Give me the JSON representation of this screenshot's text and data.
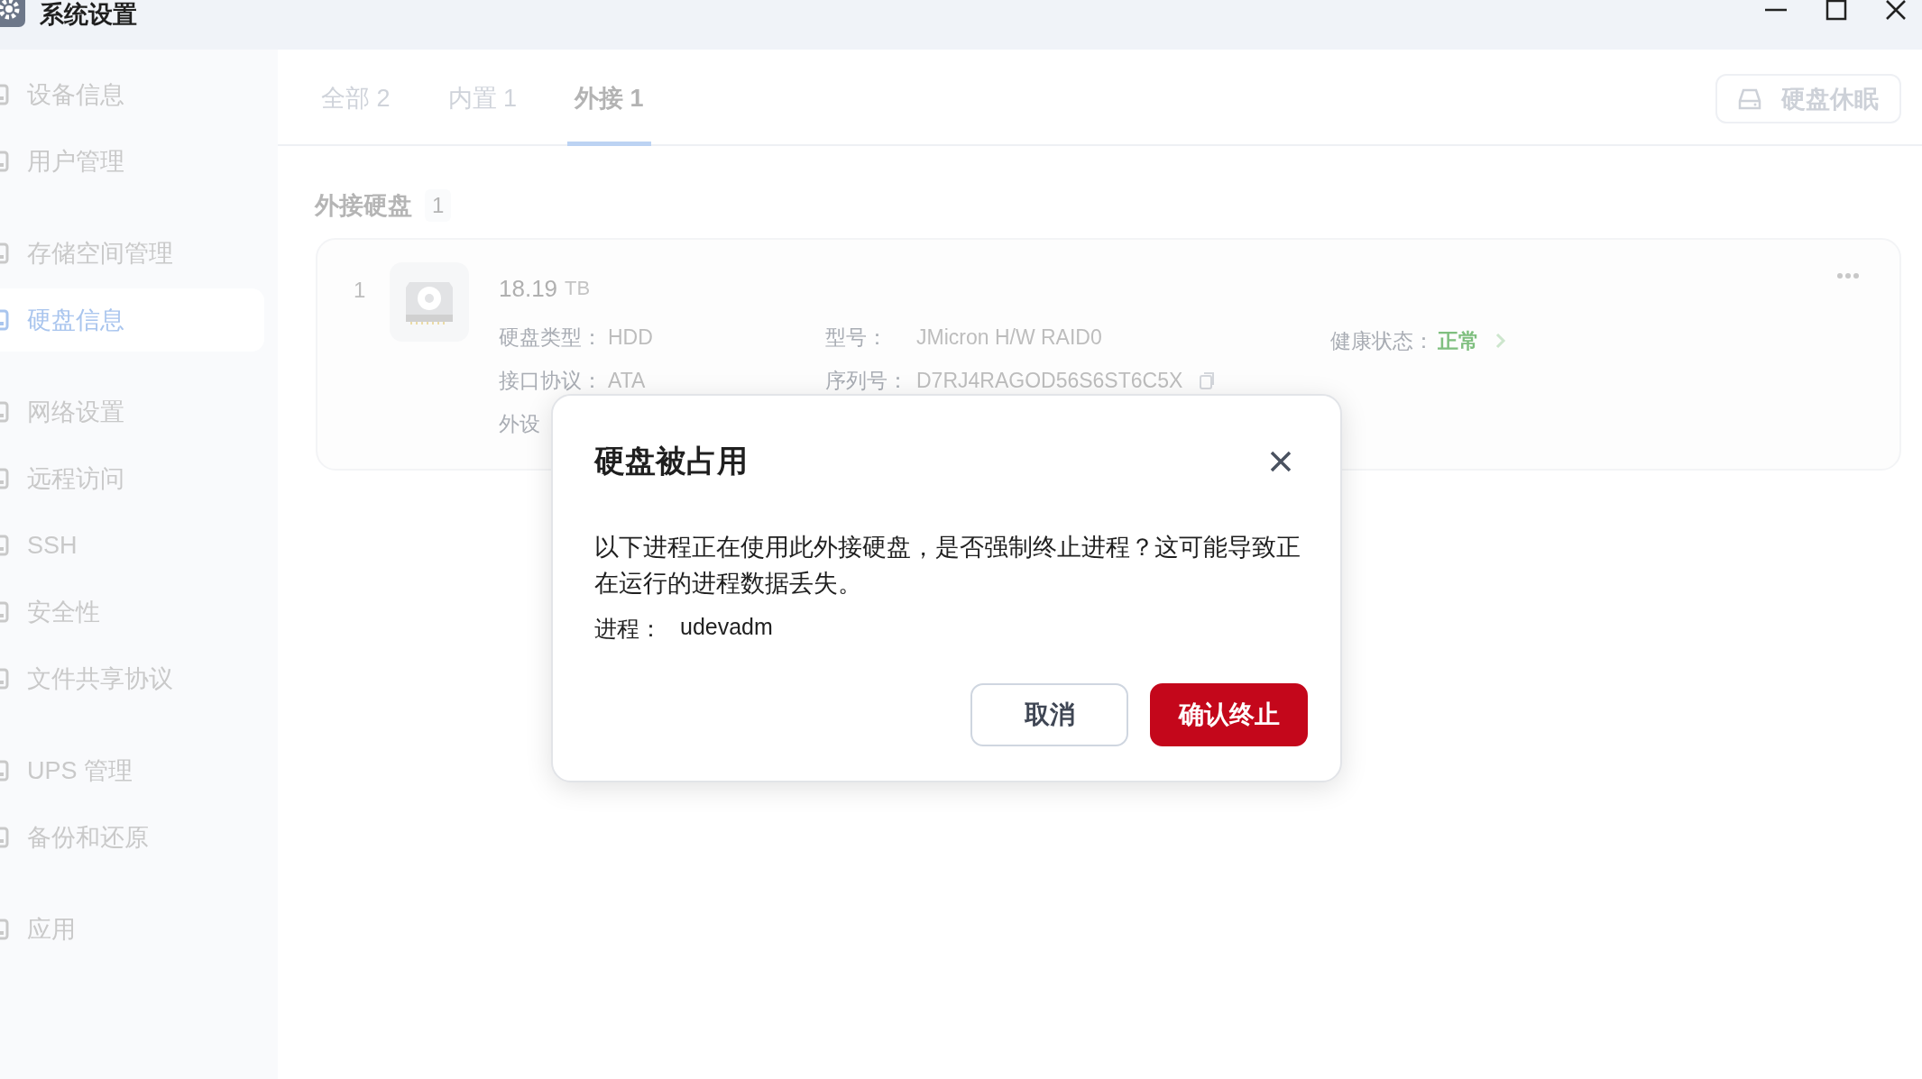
{
  "window": {
    "title": "系统设置"
  },
  "sidebar": {
    "groups": [
      [
        {
          "label": "设备信息",
          "selected": false
        },
        {
          "label": "用户管理",
          "selected": false
        }
      ],
      [
        {
          "label": "存储空间管理",
          "selected": false
        },
        {
          "label": "硬盘信息",
          "selected": true
        }
      ],
      [
        {
          "label": "网络设置",
          "selected": false
        },
        {
          "label": "远程访问",
          "selected": false
        },
        {
          "label": "SSH",
          "selected": false
        },
        {
          "label": "安全性",
          "selected": false
        },
        {
          "label": "文件共享协议",
          "selected": false
        }
      ],
      [
        {
          "label": "UPS 管理",
          "selected": false
        },
        {
          "label": "备份和还原",
          "selected": false
        }
      ],
      [
        {
          "label": "应用",
          "selected": false
        }
      ]
    ]
  },
  "tabs": [
    {
      "label": "全部 2",
      "selected": false
    },
    {
      "label": "内置 1",
      "selected": false
    },
    {
      "label": "外接 1",
      "selected": true
    }
  ],
  "toolbar": {
    "button": "硬盘休眠"
  },
  "section": {
    "title": "外接硬盘",
    "count": "1"
  },
  "disk": {
    "index": "1",
    "capacity": "18.19",
    "unit": "TB",
    "columns": [
      [
        {
          "label": "硬盘类型：",
          "value": "HDD"
        },
        {
          "label": "接口协议：",
          "value": "ATA"
        },
        {
          "label": "外设"
        }
      ],
      [
        {
          "label": "型号：",
          "value": "JMicron H/W RAID0"
        },
        {
          "label": "序列号：",
          "value": "D7RJ4RAGOD56S6ST6C5X",
          "copyable": true
        }
      ]
    ],
    "health": {
      "label": "健康状态：",
      "value": "正常"
    }
  },
  "dialog": {
    "title": "硬盘被占用",
    "message": "以下进程正在使用此外接硬盘，是否强制终止进程？这可能导致正在运行的进程数据丢失。",
    "process_label": "进程：",
    "process": "udevadm",
    "buttons": [
      {
        "label": "取消",
        "kind": "secondary"
      },
      {
        "label": "确认终止",
        "kind": "danger"
      }
    ]
  }
}
